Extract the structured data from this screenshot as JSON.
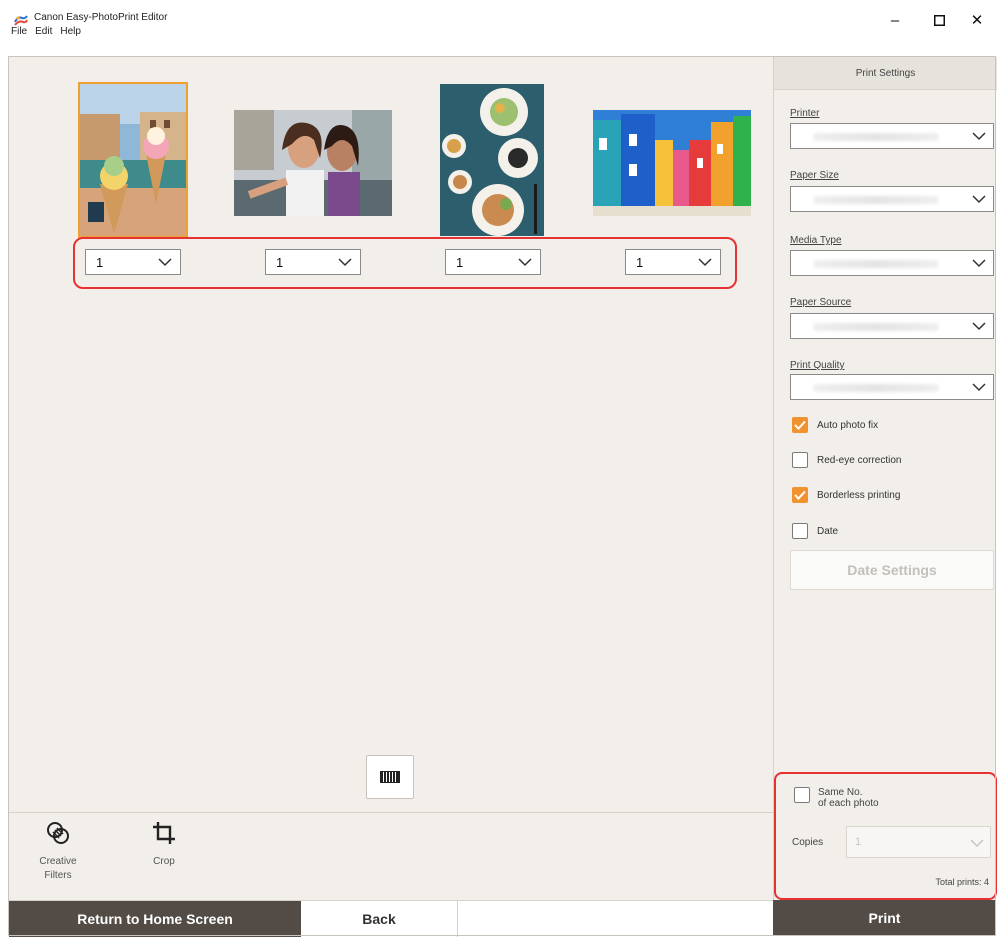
{
  "window": {
    "title": "Canon Easy-PhotoPrint Editor",
    "minimize_icon": "–",
    "maximize_icon": "☐",
    "close_icon": "✕"
  },
  "menu": [
    "File",
    "Edit",
    "Help"
  ],
  "photos": [
    {
      "name": "ice-cream-venice",
      "copies": "1",
      "selected": true
    },
    {
      "name": "selfie-friends",
      "copies": "1",
      "selected": false
    },
    {
      "name": "food-table",
      "copies": "1",
      "selected": false
    },
    {
      "name": "colorful-houses",
      "copies": "1",
      "selected": false
    }
  ],
  "tools": {
    "creative_filters": "Creative\nFilters",
    "creative_filters_line1": "Creative",
    "creative_filters_line2": "Filters",
    "crop": "Crop"
  },
  "bottom": {
    "return_home": "Return to Home Screen",
    "back": "Back",
    "print": "Print"
  },
  "print_settings": {
    "title": "Print Settings",
    "printer_label": "Printer",
    "paper_size_label": "Paper Size",
    "media_type_label": "Media Type",
    "paper_source_label": "Paper Source",
    "print_quality_label": "Print Quality",
    "options": [
      {
        "label": "Auto photo fix",
        "checked": true
      },
      {
        "label": "Red-eye correction",
        "checked": false
      },
      {
        "label": "Borderless printing",
        "checked": true
      },
      {
        "label": "Date",
        "checked": false
      }
    ],
    "date_settings": "Date Settings"
  },
  "copies": {
    "same_no_line1": "Same No.",
    "same_no_line2": "of each photo",
    "same_no_checked": false,
    "copies_label": "Copies",
    "copies_value": "1",
    "total_prints": "Total prints: 4"
  },
  "colors": {
    "accent": "#f0922e",
    "highlight": "#e63232",
    "dark_button": "#534c46",
    "canvas_bg": "#f2efea"
  }
}
